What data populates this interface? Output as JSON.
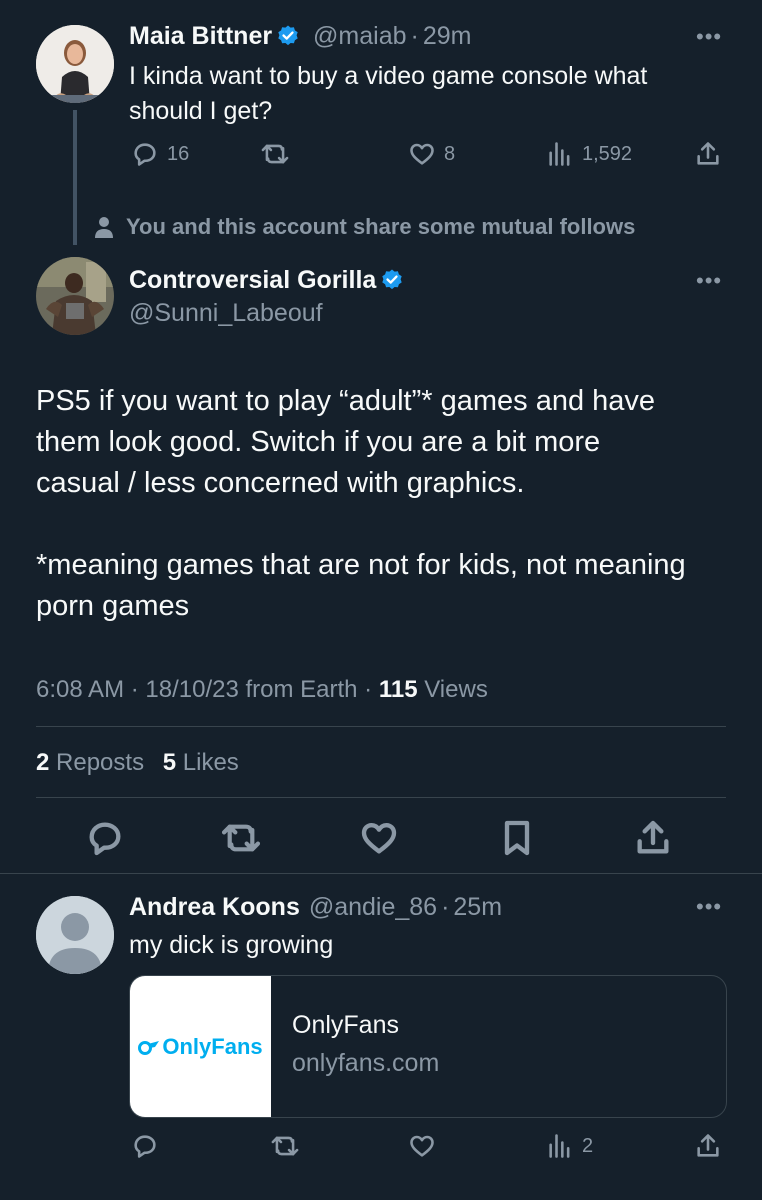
{
  "colors": {
    "background": "#15202b",
    "text": "#f7f9f9",
    "muted": "#8b98a5",
    "accent": "#1d9bf0",
    "divider": "#38444d"
  },
  "tweet1": {
    "name": "Maia Bittner",
    "handle": "@maiab",
    "time": "29m",
    "text_line1": "I kinda want to buy a video game console what",
    "text_line2": "should I get?",
    "replies": "16",
    "likes": "8",
    "views": "1,592",
    "icons": [
      "reply-icon",
      "repost-icon",
      "like-icon",
      "views-icon",
      "share-icon",
      "more-icon",
      "verified-badge-icon"
    ]
  },
  "mutual_note": "You and this account share some mutual follows",
  "main_tweet": {
    "name": "Controversial Gorilla",
    "handle": "@Sunni_Labeouf",
    "text_line1": "PS5 if you want to play “adult”* games and have",
    "text_line2": "them look good. Switch if you are a bit more",
    "text_line3": "casual / less concerned with graphics.",
    "text_line4": "*meaning games that are not for kids, not meaning",
    "text_line5": "porn games",
    "meta_time": "6:08 AM · 18/10/23 from Earth · ",
    "views_count": "115",
    "views_label": " Views",
    "reposts_count": "2",
    "reposts_label": " Reposts",
    "likes_count": "5",
    "likes_label": " Likes"
  },
  "reply": {
    "name": "Andrea Koons",
    "handle": "@andie_86",
    "time": "25m",
    "text": "my dick is growing",
    "card_logo": "OnlyFans",
    "card_title": "OnlyFans",
    "card_domain": "onlyfans.com",
    "views": "2"
  },
  "separator": "·"
}
